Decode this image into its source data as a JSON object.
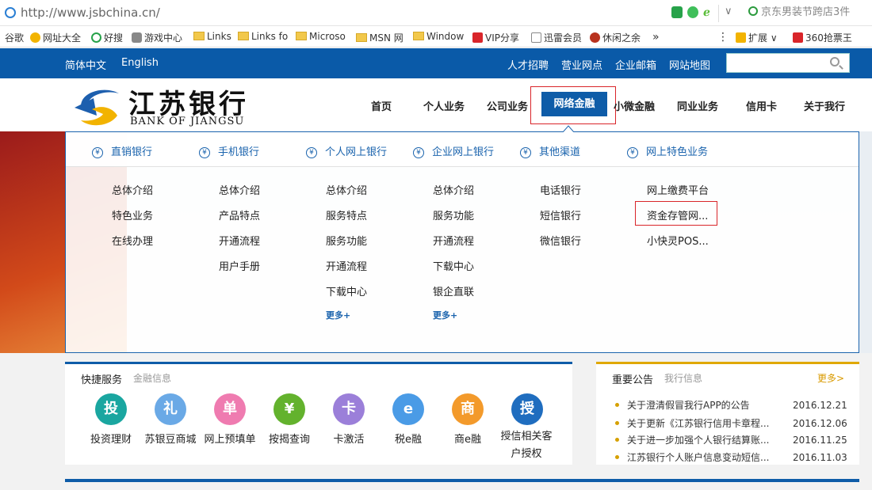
{
  "browser": {
    "url": "http://www.jsbchina.cn/",
    "search_hint": "京东男装节跨店3件",
    "bookmarks": [
      "谷歌",
      "网址大全",
      "好搜",
      "游戏中心",
      "Links",
      "Links fo",
      "Microso",
      "MSN 网",
      "Window",
      "VIP分享",
      "迅雷会员",
      "休闲之余",
      "扩展",
      "360抢票王"
    ],
    "more_glyph": "»"
  },
  "topnav": {
    "lang_cn": "简体中文",
    "lang_en": "English",
    "links": [
      "人才招聘",
      "营业网点",
      "企业邮箱",
      "网站地图"
    ]
  },
  "logo": {
    "cn": "江苏银行",
    "en": "BANK OF JIANGSU"
  },
  "mainnav": {
    "items": [
      "首页",
      "个人业务",
      "公司业务",
      "网络金融",
      "小微金融",
      "同业业务",
      "信用卡",
      "关于我行"
    ],
    "active": "网络金融"
  },
  "dropdown": {
    "columns": [
      {
        "head": "直销银行",
        "items": [
          "总体介绍",
          "特色业务",
          "在线办理"
        ],
        "more": ""
      },
      {
        "head": "手机银行",
        "items": [
          "总体介绍",
          "产品特点",
          "开通流程",
          "用户手册"
        ],
        "more": ""
      },
      {
        "head": "个人网上银行",
        "items": [
          "总体介绍",
          "服务特点",
          "服务功能",
          "开通流程",
          "下载中心"
        ],
        "more": "更多+"
      },
      {
        "head": "企业网上银行",
        "items": [
          "总体介绍",
          "服务功能",
          "开通流程",
          "下载中心",
          "银企直联"
        ],
        "more": "更多+"
      },
      {
        "head": "其他渠道",
        "items": [
          "电话银行",
          "短信银行",
          "微信银行"
        ],
        "more": ""
      },
      {
        "head": "网上特色业务",
        "items": [
          "网上缴费平台",
          "资金存管网...",
          "小快灵POS..."
        ],
        "more": ""
      }
    ],
    "yen": "¥"
  },
  "quick": {
    "title": "快捷服务",
    "subtitle": "金融信息",
    "items": [
      {
        "label": "投资理财",
        "glyph": "投",
        "color": "#1aa6a0"
      },
      {
        "label": "苏银豆商城",
        "glyph": "礼",
        "color": "#6aa9e6"
      },
      {
        "label": "网上预填单",
        "glyph": "单",
        "color": "#ef7bb0"
      },
      {
        "label": "按揭查询",
        "glyph": "¥",
        "color": "#63b22d"
      },
      {
        "label": "卡激活",
        "glyph": "卡",
        "color": "#9b7fd9"
      },
      {
        "label": "税e融",
        "glyph": "e",
        "color": "#4a9be6"
      },
      {
        "label": "商e融",
        "glyph": "商",
        "color": "#f39a2b"
      },
      {
        "label": "授信相关客户授权",
        "glyph": "授",
        "color": "#1f6dbf"
      }
    ]
  },
  "notice": {
    "title": "重要公告",
    "subtitle": "我行信息",
    "more": "更多>",
    "rows": [
      {
        "text": "关于澄清假冒我行APP的公告",
        "date": "2016.12.21"
      },
      {
        "text": "关于更新《江苏银行信用卡章程...",
        "date": "2016.12.06"
      },
      {
        "text": "关于进一步加强个人银行结算账...",
        "date": "2016.11.25"
      },
      {
        "text": "江苏银行个人账户信息变动短信...",
        "date": "2016.11.03"
      }
    ]
  },
  "colors": {
    "brand_blue": "#0e5ca8",
    "highlight_red": "#d9252a",
    "notice_gold": "#e0a800"
  }
}
